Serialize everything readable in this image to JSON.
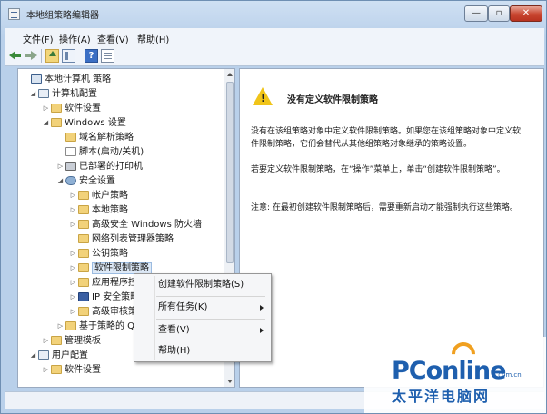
{
  "window": {
    "title": "本地组策略编辑器",
    "controls": {
      "minimize": "—",
      "maximize": "▫",
      "close": "✕"
    }
  },
  "menubar": {
    "items": [
      "文件(F)",
      "操作(A)",
      "查看(V)",
      "帮助(H)"
    ]
  },
  "toolbar": {
    "icons": [
      "back-arrow-icon",
      "forward-arrow-icon",
      "up-folder-icon",
      "show-hide-tree-icon",
      "help-icon",
      "properties-icon"
    ],
    "help_glyph": "?"
  },
  "tree": {
    "items": [
      {
        "label": "本地计算机 策略",
        "icon": "policy",
        "expander": ""
      },
      {
        "label": "计算机配置",
        "icon": "computer",
        "expander": "◢"
      },
      {
        "label": "软件设置",
        "icon": "folder",
        "expander": "▷"
      },
      {
        "label": "Windows 设置",
        "icon": "folder",
        "expander": "◢"
      },
      {
        "label": "域名解析策略",
        "icon": "folder",
        "expander": ""
      },
      {
        "label": "脚本(启动/关机)",
        "icon": "doc",
        "expander": ""
      },
      {
        "label": "已部署的打印机",
        "icon": "printer",
        "expander": "▷"
      },
      {
        "label": "安全设置",
        "icon": "gear",
        "expander": "◢"
      },
      {
        "label": "帐户策略",
        "icon": "folder",
        "expander": "▷"
      },
      {
        "label": "本地策略",
        "icon": "folder",
        "expander": "▷"
      },
      {
        "label": "高级安全 Windows 防火墙",
        "icon": "folder",
        "expander": "▷"
      },
      {
        "label": "网络列表管理器策略",
        "icon": "folder",
        "expander": ""
      },
      {
        "label": "公钥策略",
        "icon": "folder",
        "expander": "▷"
      },
      {
        "label": "软件限制策略",
        "icon": "folder",
        "expander": "▷"
      },
      {
        "label": "应用程序控",
        "icon": "folder",
        "expander": "▷"
      },
      {
        "label": "IP 安全策略",
        "icon": "shield",
        "expander": "▷"
      },
      {
        "label": "高级审核策",
        "icon": "folder",
        "expander": "▷"
      },
      {
        "label": "基于策略的 Qo",
        "icon": "folder",
        "expander": "▷"
      },
      {
        "label": "管理模板",
        "icon": "folder",
        "expander": "▷"
      },
      {
        "label": "用户配置",
        "icon": "computer",
        "expander": "◢"
      },
      {
        "label": "软件设置",
        "icon": "folder",
        "expander": "▷"
      }
    ],
    "selected_index": 13
  },
  "detail": {
    "warning_glyph": "!",
    "heading": "没有定义软件限制策略",
    "paragraph1": "没有在该组策略对象中定义软件限制策略。如果您在该组策略对象中定义软件限制策略，它们会替代从其他组策略对象继承的策略设置。",
    "paragraph2": "若要定义软件限制策略，在“操作”菜单上，单击“创建软件限制策略”。",
    "paragraph3": "注意: 在最初创建软件限制策略后，需要重新启动才能强制执行这些策略。"
  },
  "context_menu": {
    "items": [
      {
        "label": "创建软件限制策略(S)",
        "submenu": false
      },
      {
        "label": "所有任务(K)",
        "submenu": true
      },
      {
        "label": "查看(V)",
        "submenu": true
      },
      {
        "label": "帮助(H)",
        "submenu": false
      }
    ]
  },
  "watermark": {
    "brand": "PConline",
    "domain": ".com.cn",
    "chinese": "太平洋电脑网"
  }
}
